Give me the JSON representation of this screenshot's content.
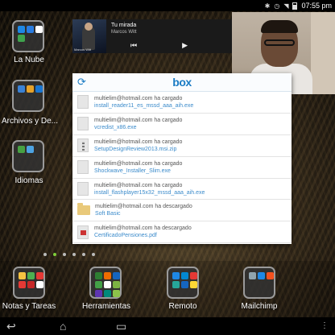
{
  "status_bar": {
    "time": "07:55 pm",
    "icons": [
      "bluetooth-icon",
      "alarm-icon",
      "wifi-icon",
      "battery-icon"
    ]
  },
  "folders": [
    {
      "label": "La Nube",
      "colors": [
        "#1e88e5",
        "#2a7de1",
        "#ffffff",
        "#3fa34d"
      ]
    },
    {
      "label": "Archivos y De...",
      "colors": [
        "#3a82d6",
        "#e6a22a",
        "#1976d2"
      ]
    },
    {
      "label": "Idiomas",
      "colors": [
        "#47a143",
        "#4da3e3"
      ]
    }
  ],
  "music": {
    "song": "Tu mirada",
    "artist": "Marcos Witt",
    "album_text": "Marcos Witt"
  },
  "box": {
    "logo": "box",
    "items": [
      {
        "user": "multielim@hotmail.com ha cargado",
        "file": "install_reader11_es_mssd_aaa_aih.exe",
        "icon": "file"
      },
      {
        "user": "multielim@hotmail.com ha cargado",
        "file": "vcredist_x86.exe",
        "icon": "file"
      },
      {
        "user": "multielim@hotmail.com ha cargado",
        "file": "SetupDesignReview2013.msi.zip",
        "icon": "zip"
      },
      {
        "user": "multielim@hotmail.com ha cargado",
        "file": "Shockwave_Installer_Slim.exe",
        "icon": "file"
      },
      {
        "user": "multielim@hotmail.com ha cargado",
        "file": "install_flashplayer15x32_mssd_aaa_aih.exe",
        "icon": "file"
      },
      {
        "user": "multielim@hotmail.com ha descargado",
        "file": "Soft Basic",
        "icon": "folder"
      },
      {
        "user": "multielim@hotmail.com ha descargado",
        "file": "CertificadoPensiones.pdf",
        "icon": "pdf"
      }
    ]
  },
  "page_dots": {
    "count": 6,
    "active": 1
  },
  "dock": [
    {
      "label": "Notas y Tareas",
      "colors": [
        "#f5c242",
        "#4caf50",
        "#e53935",
        "#e53935",
        "#c62828",
        "#ffffff"
      ]
    },
    {
      "label": "Herramientas",
      "colors": [
        "#2e7d32",
        "#ef6c00",
        "#1565c0",
        "#43a047",
        "#ffffff",
        "#7cb342",
        "#5e35b1",
        "#00897b",
        "#8bc34a"
      ]
    },
    {
      "label": "Remoto",
      "colors": [
        "#1e88e5",
        "#0288d1",
        "#e53935",
        "#26a69a",
        "#1565c0",
        "#fdd835"
      ]
    },
    {
      "label": "Mailchimp",
      "colors": [
        "#90a4ae",
        "#1e88e5",
        "#f4511e"
      ]
    }
  ],
  "navbar": {
    "icons": [
      "back-icon",
      "home-icon",
      "recents-icon",
      "menu-icon"
    ]
  }
}
